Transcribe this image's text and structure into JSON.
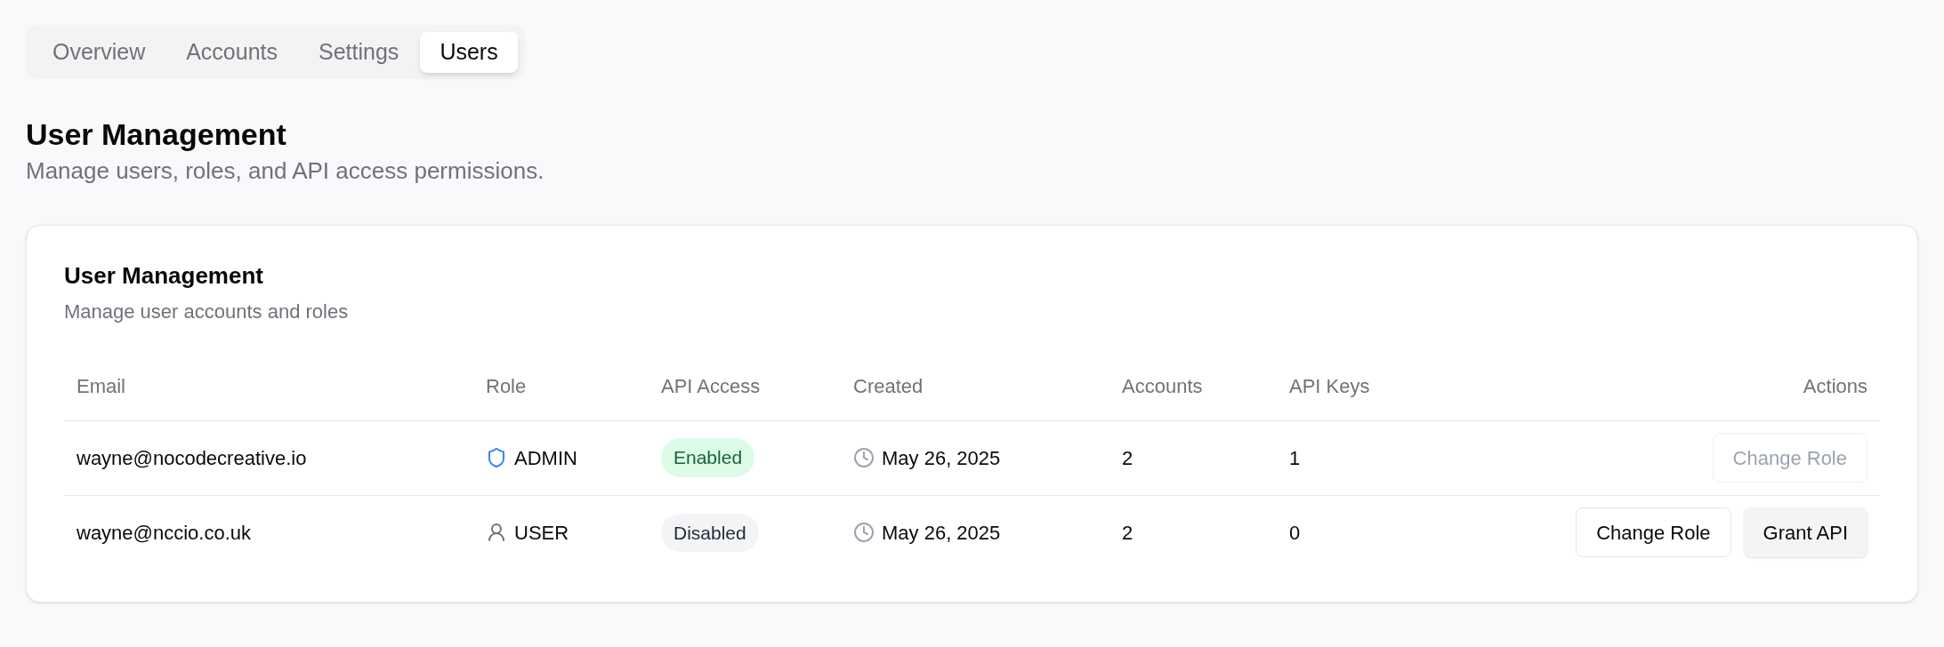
{
  "tabs": [
    {
      "label": "Overview",
      "selected": false
    },
    {
      "label": "Accounts",
      "selected": false
    },
    {
      "label": "Settings",
      "selected": false
    },
    {
      "label": "Users",
      "selected": true
    }
  ],
  "page": {
    "title": "User Management",
    "subtitle": "Manage users, roles, and API access permissions."
  },
  "card": {
    "title": "User Management",
    "subtitle": "Manage user accounts and roles"
  },
  "table": {
    "columns": [
      "Email",
      "Role",
      "API Access",
      "Created",
      "Accounts",
      "API Keys",
      "Actions"
    ],
    "rows": [
      {
        "email": "wayne@nocodecreative.io",
        "role": {
          "kind": "admin",
          "label": "ADMIN"
        },
        "api_access": {
          "label": "Enabled",
          "enabled": true
        },
        "created": "May 26, 2025",
        "accounts": "2",
        "api_keys": "1",
        "actions": [
          {
            "label": "Change Role",
            "kind": "outline",
            "disabled": true
          }
        ]
      },
      {
        "email": "wayne@nccio.co.uk",
        "role": {
          "kind": "user",
          "label": "USER"
        },
        "api_access": {
          "label": "Disabled",
          "enabled": false
        },
        "created": "May 26, 2025",
        "accounts": "2",
        "api_keys": "0",
        "actions": [
          {
            "label": "Change Role",
            "kind": "outline",
            "disabled": false
          },
          {
            "label": "Grant API",
            "kind": "secondary",
            "disabled": false
          }
        ]
      }
    ]
  }
}
